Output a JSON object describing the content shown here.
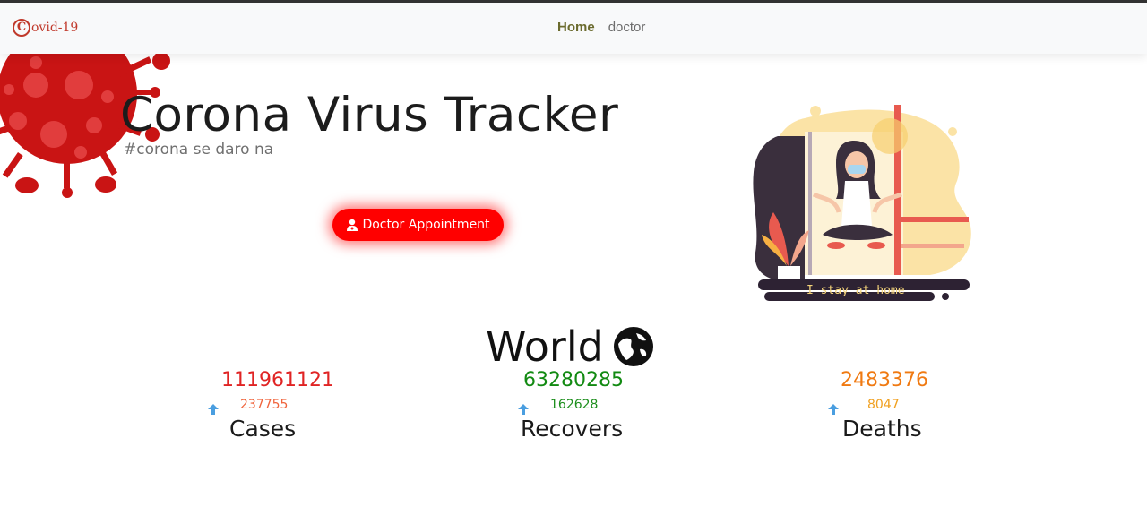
{
  "nav": {
    "brand_text": "ovid-19",
    "brand_letter": "C",
    "links": [
      {
        "label": "Home",
        "active": true
      },
      {
        "label": "doctor",
        "active": false
      }
    ]
  },
  "hero": {
    "title": "Corona Virus Tracker",
    "subtitle": "#corona se daro na",
    "button_label": "Doctor Appointment",
    "illustration_caption": "I stay at home"
  },
  "world": {
    "title": "World",
    "stats": [
      {
        "label": "Cases",
        "total": "111961121",
        "delta": "237755",
        "color": "#e02424",
        "delta_color": "#f0643c"
      },
      {
        "label": "Recovers",
        "total": "63280285",
        "delta": "162628",
        "color": "#128a12",
        "delta_color": "#1e8f1e"
      },
      {
        "label": "Deaths",
        "total": "2483376",
        "delta": "8047",
        "color": "#f07a12",
        "delta_color": "#f0a020"
      }
    ]
  },
  "colors": {
    "accent": "#ff0000",
    "virus": "#c91414",
    "nav_bg": "#f8f9fa"
  },
  "icons": {
    "brand": "brand-c-icon",
    "button": "doctor-icon",
    "world": "globe-icon",
    "stat": "arrow-up-icon"
  }
}
